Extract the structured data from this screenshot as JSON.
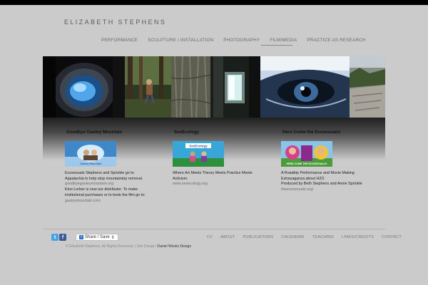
{
  "site": {
    "title": "ELIZABETH STEPHENS"
  },
  "nav": [
    {
      "label": "PERFORMANCE"
    },
    {
      "label": "SCULPTURE / INSTALLATION"
    },
    {
      "label": "PHOTOGRAPHY"
    },
    {
      "label": "FILM/MEDIA"
    },
    {
      "label": "PRACTICE AS RESEARCH"
    }
  ],
  "features": [
    {
      "title": "Goodbye Gauley Mountain",
      "lines": [
        "Ecosexuals Stephens and Sprinkle go to Appalachia to help stop mountaintop removal.",
        "goodbyegauleymountain.org",
        "Kino Lorber is now our distributor. To make institutional purchases or to book the film go to:",
        "gauleymountain.com"
      ]
    },
    {
      "title": "SexEcology",
      "lines": [
        "Where Art Meets Theory Meets Practice Meets Activism.",
        "www.sexecology.org"
      ]
    },
    {
      "title": "Here Come the Ecosexuals!",
      "lines": [
        "A Roadtrip Performance and Movie Making Extravaganza about H2O",
        "Produced by Beth Stephens and Annie Sprinkle",
        "theecosexuals.org/"
      ]
    }
  ],
  "thumb_text": {
    "gauley": "Gauley Mountain",
    "sexecology": "SexEcology",
    "ecosexuals": "HERE COME THE ECOSEXUALS!"
  },
  "social": {
    "twitter_glyph": "t",
    "facebook_glyph": "f"
  },
  "share": {
    "label": "Share / Save",
    "arrows": "⇕"
  },
  "footer_nav": [
    {
      "label": "CV"
    },
    {
      "label": "ABOUT"
    },
    {
      "label": "PUBLICATIONS"
    },
    {
      "label": "CALENDAR"
    },
    {
      "label": "TEACHING"
    },
    {
      "label": "LINKS/CREDITS"
    },
    {
      "label": "CONTACT"
    }
  ],
  "copyright": {
    "text": "© Elizabeth Stephens. All Rights Reserved. | Site Design:",
    "designer": "Daniel Wesko Design"
  },
  "colors": {
    "accent_blue": "#4aa3df",
    "facebook_blue": "#3b5998",
    "background": "#cbcbcb"
  }
}
